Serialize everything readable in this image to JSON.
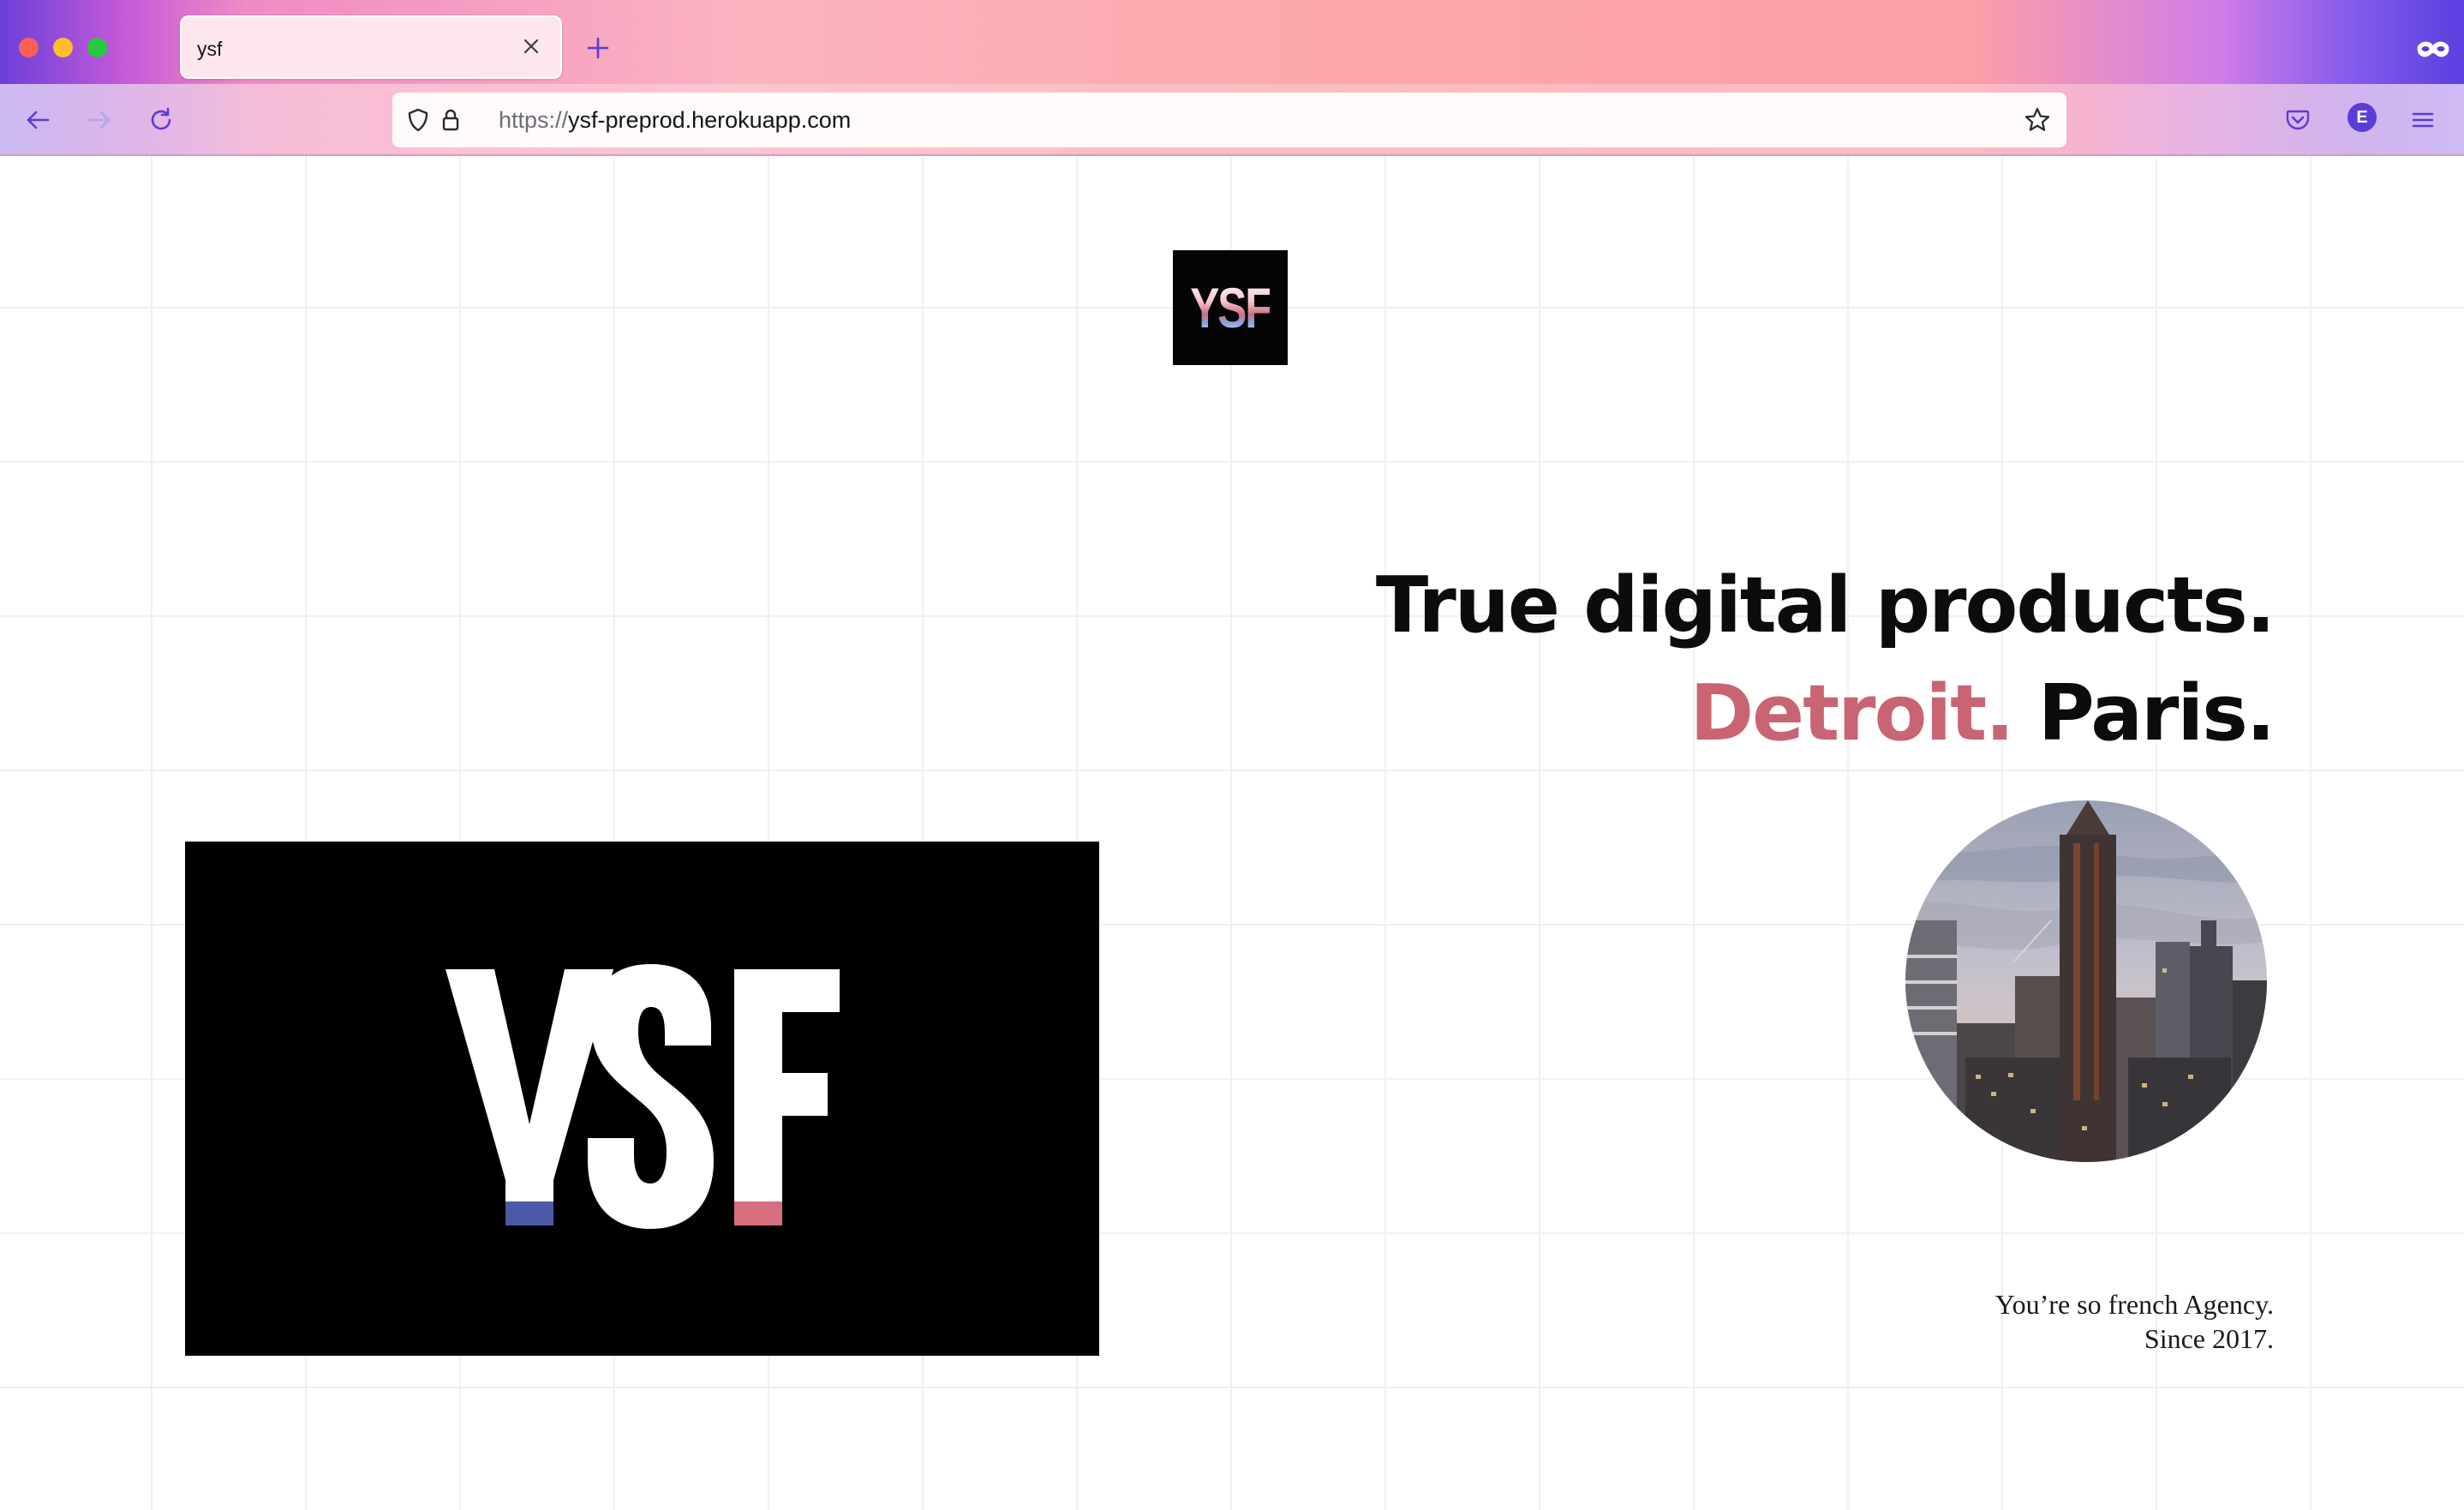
{
  "browser": {
    "tab_title": "ysf",
    "tab_close_icon": "close-icon",
    "new_tab_icon": "plus-icon",
    "url_scheme": "https://",
    "url_host": "ysf-preprod.herokuapp.com",
    "profile_initial": "E",
    "accent_color": "#5b3cd6"
  },
  "site": {
    "logo_text": "YSF",
    "headline_line1": "True digital products.",
    "city1": "Detroit.",
    "city2": "Paris.",
    "tagline_line1": "You’re so french Agency.",
    "tagline_line2": "Since 2017.",
    "accent_color": "#c96473",
    "flag_blue": "#4a5aa8",
    "flag_red": "#d86d7d"
  }
}
